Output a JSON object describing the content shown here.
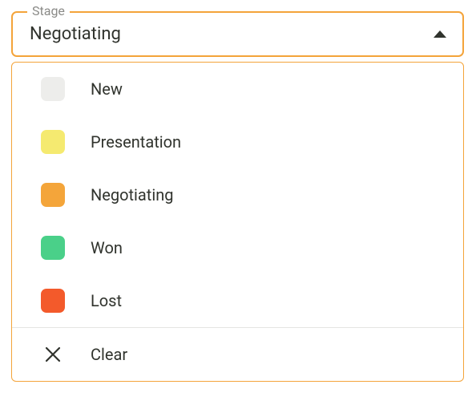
{
  "select": {
    "label": "Stage",
    "value": "Negotiating",
    "options": [
      {
        "label": "New",
        "color": "#ededeb"
      },
      {
        "label": "Presentation",
        "color": "#f5ea70"
      },
      {
        "label": "Negotiating",
        "color": "#f4a53a"
      },
      {
        "label": "Won",
        "color": "#4ad089"
      },
      {
        "label": "Lost",
        "color": "#f35a2b"
      }
    ],
    "clear_label": "Clear"
  }
}
